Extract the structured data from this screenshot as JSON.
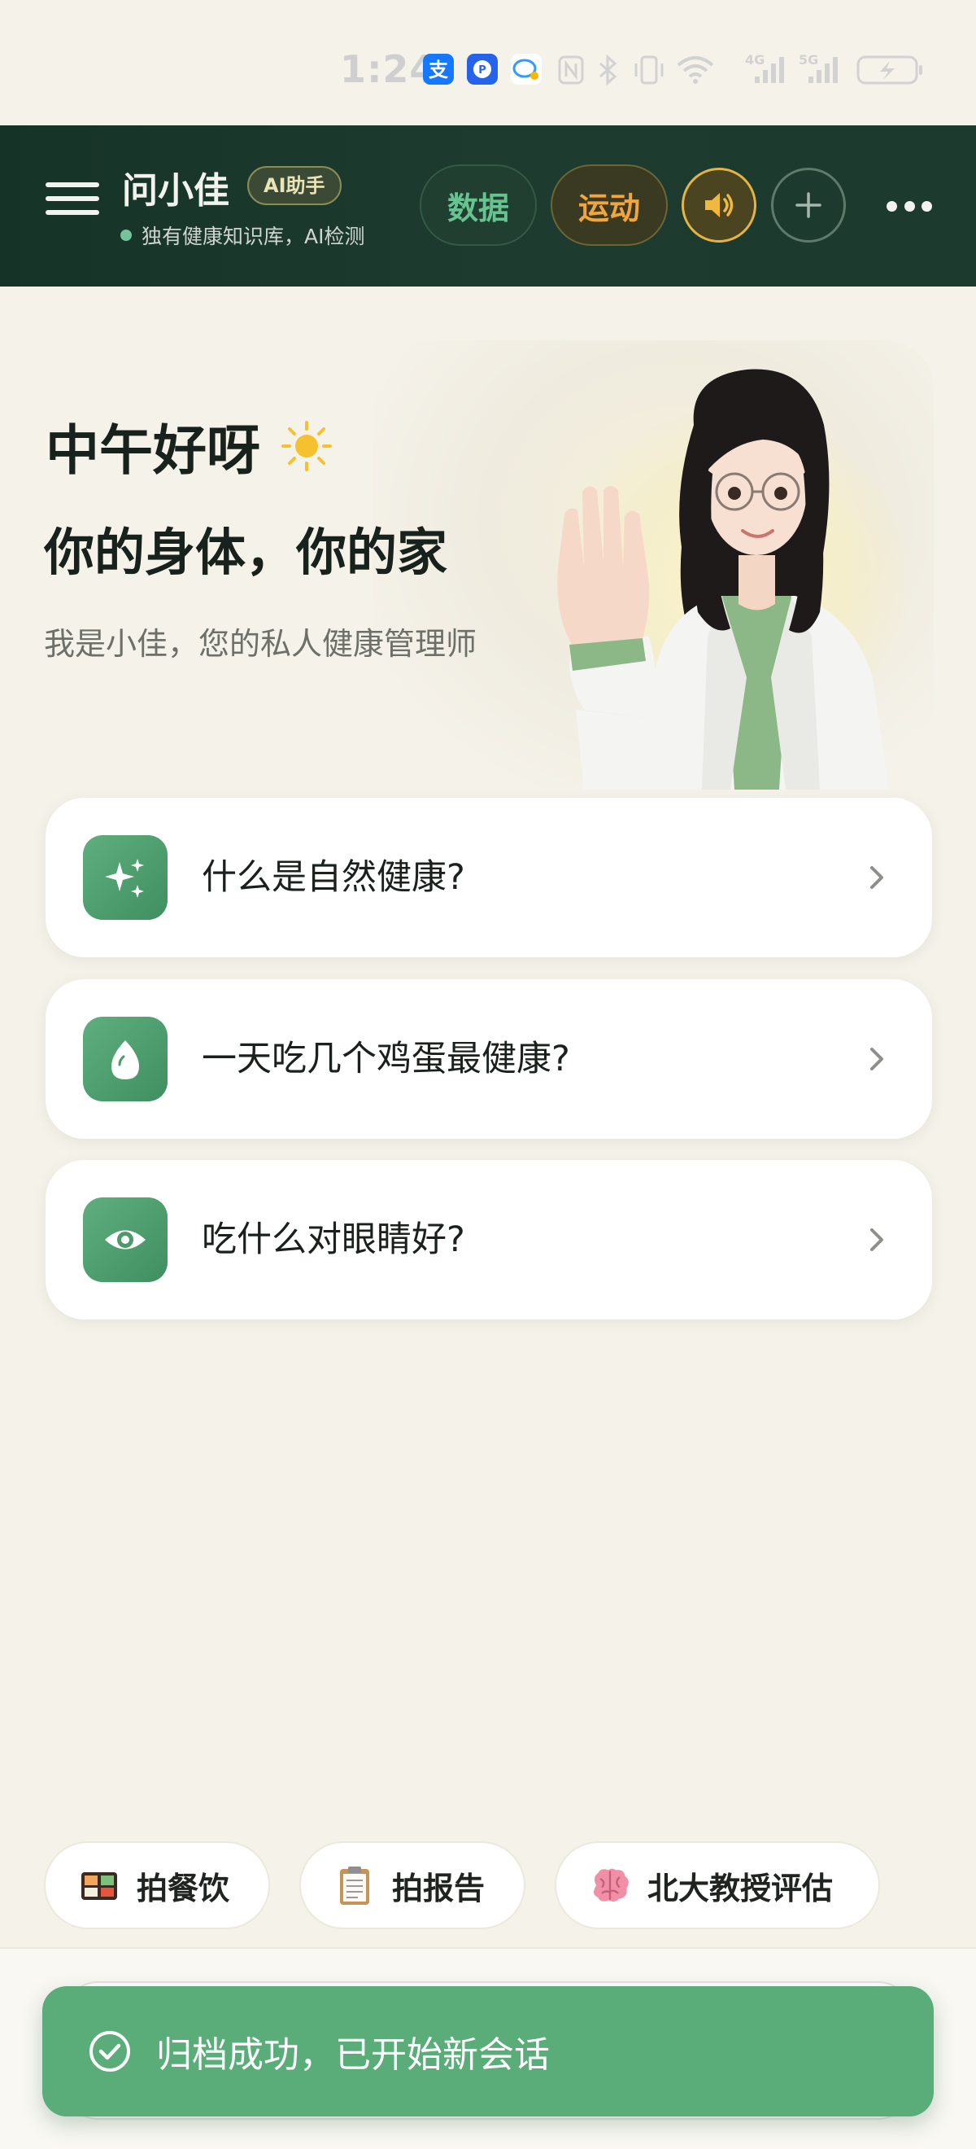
{
  "status_bar": {
    "time": "1:24",
    "network_4g": "4G",
    "network_5g": "5G"
  },
  "header": {
    "title": "问小佳",
    "badge": "AI助手",
    "subtitle": "独有健康知识库，AI检测",
    "tabs": {
      "data_label": "数据",
      "sport_label": "运动"
    }
  },
  "hero": {
    "greeting": "中午好呀",
    "slogan": "你的身体，你的家",
    "intro": "我是小佳，您的私人健康管理师"
  },
  "questions": [
    {
      "icon": "sparkles-icon",
      "text": "什么是自然健康?"
    },
    {
      "icon": "egg-icon",
      "text": "一天吃几个鸡蛋最健康?"
    },
    {
      "icon": "eye-icon",
      "text": "吃什么对眼睛好?"
    }
  ],
  "quick_actions": [
    {
      "icon": "bento-box-icon",
      "label": "拍餐饮"
    },
    {
      "icon": "clipboard-icon",
      "label": "拍报告"
    },
    {
      "icon": "brain-icon",
      "label": "北大教授评估"
    }
  ],
  "toast": {
    "message": "归档成功，已开始新会话"
  },
  "colors": {
    "header_bg": "#1b392c",
    "accent_green": "#5aad78",
    "accent_orange": "#f0a63c",
    "page_bg": "#f5f2ea"
  }
}
